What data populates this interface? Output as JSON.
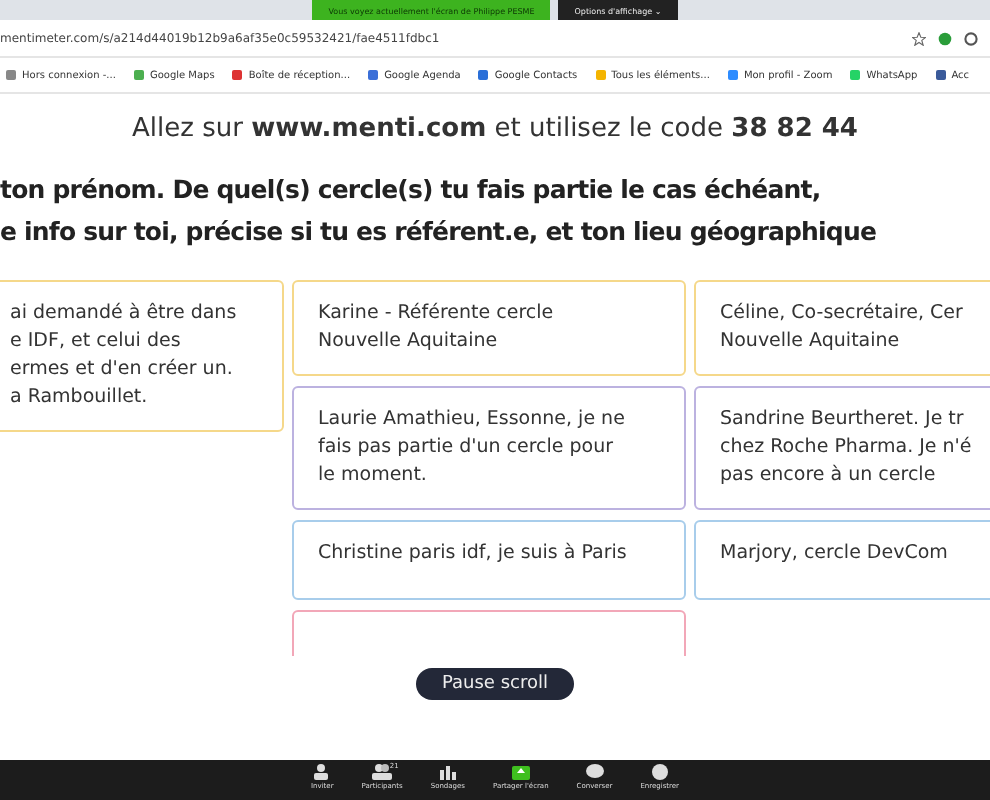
{
  "share_banner": {
    "notice": "Vous voyez actuellement l'écran de Philippe PESME",
    "options": "Options d'affichage ⌄"
  },
  "address_bar": {
    "url": "mentimeter.com/s/a214d44019b12b9a6af35e0c59532421/fae4511fdbc1"
  },
  "bookmarks": [
    "Hors connexion -...",
    "Google Maps",
    "Boîte de réception...",
    "Google Agenda",
    "Google Contacts",
    "Tous les éléments...",
    "Mon profil - Zoom",
    "WhatsApp",
    "Acc"
  ],
  "join_line": {
    "before": "Allez sur",
    "site": "www.menti.com",
    "middle": "et utilisez le code",
    "code": "38 82 44"
  },
  "question": [
    "ton prénom. De quel(s) cercle(s) tu fais partie le cas échéant,",
    "e info sur toi, précise si tu es référent.e, et ton lieu géographique"
  ],
  "columns": [
    {
      "cards": [
        {
          "color": "#f5d88a",
          "lines": [
            "ai demandé à être dans",
            "e IDF, et celui des",
            "ermes et d'en créer un.",
            "a Rambouillet."
          ]
        }
      ]
    },
    {
      "cards": [
        {
          "color": "#f5d88a",
          "lines": [
            "Karine - Référente cercle",
            "Nouvelle Aquitaine"
          ]
        },
        {
          "color": "#bcb2e0",
          "lines": [
            "Laurie Amathieu, Essonne, je ne",
            "fais pas partie d'un cercle pour",
            "le moment."
          ]
        },
        {
          "color": "#a8cdeb",
          "lines": [
            "Christine paris idf, je suis à Paris"
          ]
        },
        {
          "color": "#f2a7b8"
        }
      ]
    },
    {
      "cards": [
        {
          "color": "#f5d88a",
          "lines": [
            "Céline, Co-secrétaire, Cer",
            "Nouvelle Aquitaine"
          ]
        },
        {
          "color": "#bcb2e0",
          "lines": [
            "Sandrine Beurtheret. Je tr",
            "chez Roche Pharma. Je n'é",
            "pas encore à un cercle"
          ]
        },
        {
          "color": "#a8cdeb",
          "lines": [
            "Marjory, cercle DevCom"
          ]
        }
      ]
    }
  ],
  "pause_button": "Pause scroll",
  "zoom_toolbar": [
    {
      "kind": "invite",
      "label": "Inviter"
    },
    {
      "kind": "participants",
      "label": "Participants",
      "count": "21"
    },
    {
      "kind": "polls",
      "label": "Sondages"
    },
    {
      "kind": "share",
      "label": "Partager l'écran"
    },
    {
      "kind": "chat",
      "label": "Converser"
    },
    {
      "kind": "record",
      "label": "Enregistrer"
    }
  ]
}
